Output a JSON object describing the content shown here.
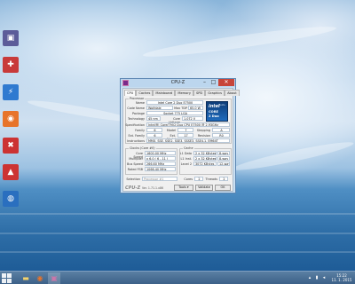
{
  "desktop": {
    "icons": [
      {
        "label": "",
        "glyph": "▣",
        "color": "#5c5c99"
      },
      {
        "label": "",
        "glyph": "✚",
        "color": "#c83a3a"
      },
      {
        "label": "",
        "glyph": "⚡",
        "color": "#2f7ad0"
      },
      {
        "label": "",
        "glyph": "◉",
        "color": "#e7742a"
      },
      {
        "label": "",
        "glyph": "✖",
        "color": "#c33"
      },
      {
        "label": "",
        "glyph": "▲",
        "color": "#cc3333"
      },
      {
        "label": "",
        "glyph": "◍",
        "color": "#2a6fbf"
      }
    ]
  },
  "window": {
    "title": "CPU-Z",
    "tabs": [
      "CPU",
      "Caches",
      "Mainboard",
      "Memory",
      "SPD",
      "Graphics",
      "About"
    ],
    "processor": {
      "group_label": "Processor",
      "name_label": "Name",
      "name": "Intel Core 2 Duo E7500",
      "codename_label": "Code Name",
      "codename": "Wolfdale",
      "maxtdp_label": "Max TDP",
      "maxtdp": "65.0 W",
      "package_label": "Package",
      "package": "Socket 775 LGA",
      "technology_label": "Technology",
      "technology": "45 nm",
      "corevoltage_label": "Core Voltage",
      "corevoltage": "1.072 V",
      "spec_label": "Specification",
      "spec": "Intel(R) Core(TM)2 Duo CPU  E7500 @ 2.93GHz",
      "family_label": "Family",
      "family": "6",
      "model_label": "Model",
      "model": "7",
      "stepping_label": "Stepping",
      "stepping": "A",
      "extfamily_label": "Ext. Family",
      "extfamily": "6",
      "extmodel_label": "Ext. Model",
      "extmodel": "17",
      "revision_label": "Revision",
      "revision": "R0",
      "instructions_label": "Instructions",
      "instructions": "MMX, SSE, SSE2, SSE3, SSSE3, SSE4.1, EM64T"
    },
    "clocks": {
      "group_label": "Clocks (Core #0)",
      "corespeed_label": "Core Speed",
      "corespeed": "1600.00 MHz",
      "multiplier_label": "Multiplier",
      "multiplier": "x 6.0 ( 6 - 11 )",
      "busspeed_label": "Bus Speed",
      "busspeed": "266.60 MHz",
      "ratedfsb_label": "Rated FSB",
      "ratedfsb": "1066.40 MHz"
    },
    "cache": {
      "group_label": "Cache",
      "l1d_label": "L1 Data",
      "l1d": "2 x 32 KBytes",
      "l1d_way": "8-way",
      "l1i_label": "L1 Inst.",
      "l1i": "2 x 32 KBytes",
      "l1i_way": "8-way",
      "l2_label": "Level 2",
      "l2": "3072 KBytes",
      "l2_way": "12-way"
    },
    "selection_label": "Selection",
    "selection_value": "Processor #1",
    "cores_label": "Cores",
    "cores": "2",
    "threads_label": "Threads",
    "threads": "2",
    "logo_text": "CPU-Z",
    "version": "Ver. 1.71.1.x86",
    "tools_label": "Tools",
    "validate_label": "Validate",
    "ok_label": "OK",
    "intel_brand": "intel",
    "intel_inside": "inside",
    "intel_line1": "CORE",
    "intel_line2": "2 Duo"
  },
  "taskbar": {
    "time": "15:22",
    "date": "11. 1. 2015"
  }
}
